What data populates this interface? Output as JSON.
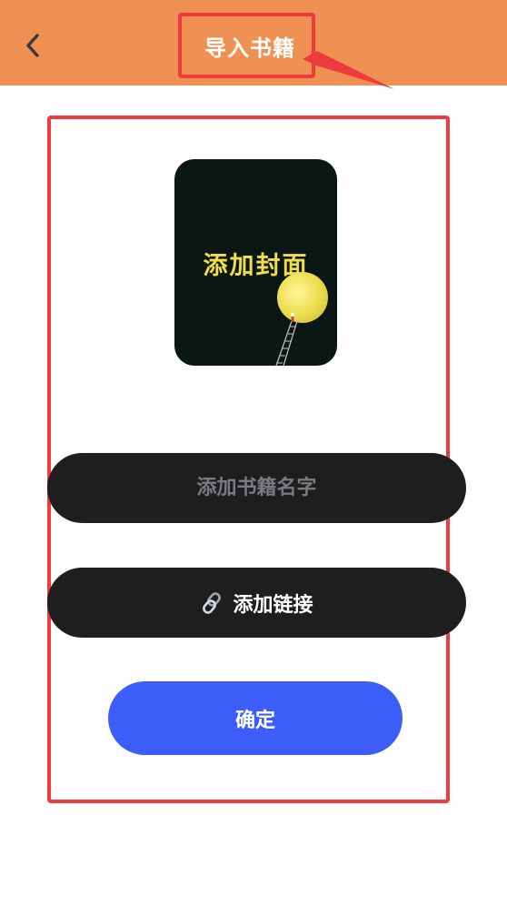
{
  "header": {
    "title": "导入书籍",
    "back_icon": "chevron-left-icon",
    "background_color": "#ef9152"
  },
  "cover": {
    "label": "添加封面",
    "background_color": "#0b1715",
    "label_color": "#f2dd45"
  },
  "form": {
    "name_placeholder": "添加书籍名字",
    "name_value": "",
    "link_label": "添加链接",
    "link_icon": "link-icon",
    "field_color": "#1e1e1e"
  },
  "actions": {
    "confirm_label": "确定",
    "confirm_color": "#3c5df7"
  },
  "annotation": {
    "highlight_color": "#ee3b3e"
  }
}
